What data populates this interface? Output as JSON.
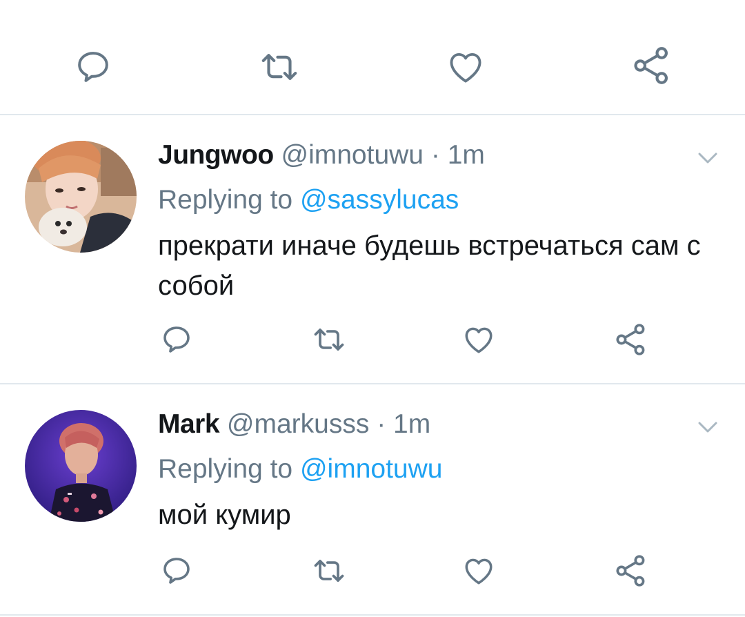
{
  "colors": {
    "icon": "#657786",
    "divider": "#e1e8ed",
    "link": "#1da1f2",
    "text": "#14171a",
    "muted": "#657786"
  },
  "top_actions": [
    "reply-icon",
    "retweet-icon",
    "like-icon",
    "share-icon"
  ],
  "tweets": [
    {
      "name": "Jungwoo",
      "handle": "@imnotuwu",
      "separator": "·",
      "time": "1m",
      "replying_prefix": "Replying to ",
      "replying_to": "@sassylucas",
      "text": "прекрати иначе будешь встречаться сам с собой",
      "actions": [
        "reply-icon",
        "retweet-icon",
        "like-icon",
        "share-icon"
      ]
    },
    {
      "name": "Mark",
      "handle": "@markusss",
      "separator": "·",
      "time": "1m",
      "replying_prefix": "Replying to ",
      "replying_to": "@imnotuwu",
      "text": "мой кумир",
      "actions": [
        "reply-icon",
        "retweet-icon",
        "like-icon",
        "share-icon"
      ]
    }
  ]
}
